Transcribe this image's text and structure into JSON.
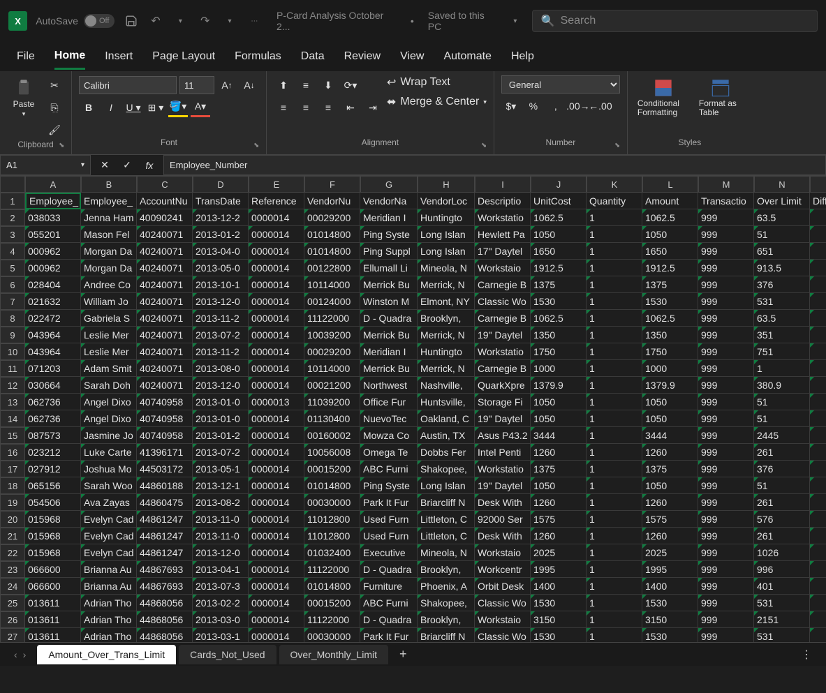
{
  "app": {
    "icon_letter": "X",
    "autosave_label": "AutoSave",
    "autosave_state": "Off",
    "filename": "P-Card Analysis October 2...",
    "save_status": "Saved to this PC",
    "search_placeholder": "Search"
  },
  "tabs": {
    "file": "File",
    "home": "Home",
    "insert": "Insert",
    "page_layout": "Page Layout",
    "formulas": "Formulas",
    "data": "Data",
    "review": "Review",
    "view": "View",
    "automate": "Automate",
    "help": "Help"
  },
  "ribbon": {
    "clipboard": {
      "paste": "Paste",
      "label": "Clipboard"
    },
    "font": {
      "name": "Calibri",
      "size": "11",
      "label": "Font"
    },
    "alignment": {
      "wrap": "Wrap Text",
      "merge": "Merge & Center",
      "label": "Alignment"
    },
    "number": {
      "format": "General",
      "label": "Number"
    },
    "styles": {
      "conditional": "Conditional Formatting",
      "format_table": "Format as Table",
      "label": "Styles"
    }
  },
  "name_box": "A1",
  "formula_bar": "Employee_Number",
  "columns": [
    "A",
    "B",
    "C",
    "D",
    "E",
    "F",
    "G",
    "H",
    "I",
    "J",
    "K",
    "L",
    "M",
    "N"
  ],
  "headers": [
    "Employee_",
    "Employee_",
    "AccountNu",
    "TransDate",
    "Reference",
    "VendorNu",
    "VendorNa",
    "VendorLoc",
    "Descriptio",
    "UnitCost",
    "Quantity",
    "Amount",
    "Transactio",
    "Over Limit",
    "Diff"
  ],
  "rows": [
    [
      "038033",
      "Jenna Ham",
      "40090241",
      "2013-12-2",
      "0000014",
      "00029200",
      "Meridian I",
      "Huntingto",
      "Workstatio",
      "1062.5",
      "1",
      "1062.5",
      "999",
      "63.5"
    ],
    [
      "055201",
      "Mason Fel",
      "40240071",
      "2013-01-2",
      "0000014",
      "01014800",
      "Ping Syste",
      "Long Islan",
      "Hewlett Pa",
      "1050",
      "1",
      "1050",
      "999",
      "51"
    ],
    [
      "000962",
      "Morgan Da",
      "40240071",
      "2013-04-0",
      "0000014",
      "01014800",
      "Ping Suppl",
      "Long Islan",
      "17\" Daytel",
      "1650",
      "1",
      "1650",
      "999",
      "651"
    ],
    [
      "000962",
      "Morgan Da",
      "40240071",
      "2013-05-0",
      "0000014",
      "00122800",
      "Ellumall Li",
      "Mineola, N",
      "Workstaio",
      "1912.5",
      "1",
      "1912.5",
      "999",
      "913.5"
    ],
    [
      "028404",
      "Andree Co",
      "40240071",
      "2013-10-1",
      "0000014",
      "10114000",
      "Merrick Bu",
      "Merrick, N",
      "Carnegie B",
      "1375",
      "1",
      "1375",
      "999",
      "376"
    ],
    [
      "021632",
      "William Jo",
      "40240071",
      "2013-12-0",
      "0000014",
      "00124000",
      "Winston M",
      "Elmont, NY",
      "Classic Wo",
      "1530",
      "1",
      "1530",
      "999",
      "531"
    ],
    [
      "022472",
      "Gabriela S",
      "40240071",
      "2013-11-2",
      "0000014",
      "11122000",
      "D - Quadra",
      "Brooklyn, ",
      "Carnegie B",
      "1062.5",
      "1",
      "1062.5",
      "999",
      "63.5"
    ],
    [
      "043964",
      "Leslie Mer",
      "40240071",
      "2013-07-2",
      "0000014",
      "10039200",
      "Merrick Bu",
      "Merrick, N",
      "19\" Daytel",
      "1350",
      "1",
      "1350",
      "999",
      "351"
    ],
    [
      "043964",
      "Leslie Mer",
      "40240071",
      "2013-11-2",
      "0000014",
      "00029200",
      "Meridian I",
      "Huntingto",
      "Workstatio",
      "1750",
      "1",
      "1750",
      "999",
      "751"
    ],
    [
      "071203",
      "Adam Smit",
      "40240071",
      "2013-08-0",
      "0000014",
      "10114000",
      "Merrick Bu",
      "Merrick, N",
      "Carnegie B",
      "1000",
      "1",
      "1000",
      "999",
      "1"
    ],
    [
      "030664",
      "Sarah Doh",
      "40240071",
      "2013-12-0",
      "0000014",
      "00021200",
      "Northwest",
      "Nashville, ",
      "QuarkXpre",
      "1379.9",
      "1",
      "1379.9",
      "999",
      "380.9"
    ],
    [
      "062736",
      "Angel Dixo",
      "40740958",
      "2013-01-0",
      "0000013",
      "11039200",
      "Office Fur",
      "Huntsville,",
      "Storage Fi",
      "1050",
      "1",
      "1050",
      "999",
      "51"
    ],
    [
      "062736",
      "Angel Dixo",
      "40740958",
      "2013-01-0",
      "0000014",
      "01130400",
      "NuevoTec",
      "Oakland, C",
      "19\" Daytel",
      "1050",
      "1",
      "1050",
      "999",
      "51"
    ],
    [
      "087573",
      "Jasmine Jo",
      "40740958",
      "2013-01-2",
      "0000014",
      "00160002",
      "Mowza Co",
      "Austin, TX",
      "Asus P43.2",
      "3444",
      "1",
      "3444",
      "999",
      "2445"
    ],
    [
      "023212",
      "Luke Carte",
      "41396171",
      "2013-07-2",
      "0000014",
      "10056008",
      "Omega Te",
      "Dobbs Fer",
      "Intel Penti",
      "1260",
      "1",
      "1260",
      "999",
      "261"
    ],
    [
      "027912",
      "Joshua Mo",
      "44503172",
      "2013-05-1",
      "0000014",
      "00015200",
      "ABC Furni",
      "Shakopee,",
      "Workstatio",
      "1375",
      "1",
      "1375",
      "999",
      "376"
    ],
    [
      "065156",
      "Sarah Woo",
      "44860188",
      "2013-12-1",
      "0000014",
      "01014800",
      "Ping Syste",
      "Long Islan",
      "19\" Daytel",
      "1050",
      "1",
      "1050",
      "999",
      "51"
    ],
    [
      "054506",
      "Ava Zayas",
      "44860475",
      "2013-08-2",
      "0000014",
      "00030000",
      "Park It Fur",
      "Briarcliff N",
      "Desk With",
      "1260",
      "1",
      "1260",
      "999",
      "261"
    ],
    [
      "015968",
      "Evelyn Cad",
      "44861247",
      "2013-11-0",
      "0000014",
      "11012800",
      "Used Furn",
      "Littleton, C",
      "92000 Ser",
      "1575",
      "1",
      "1575",
      "999",
      "576"
    ],
    [
      "015968",
      "Evelyn Cad",
      "44861247",
      "2013-11-0",
      "0000014",
      "11012800",
      "Used Furn",
      "Littleton, C",
      "Desk With",
      "1260",
      "1",
      "1260",
      "999",
      "261"
    ],
    [
      "015968",
      "Evelyn Cad",
      "44861247",
      "2013-12-0",
      "0000014",
      "01032400",
      "Executive ",
      "Mineola, N",
      "Workstaio",
      "2025",
      "1",
      "2025",
      "999",
      "1026"
    ],
    [
      "066600",
      "Brianna Au",
      "44867693",
      "2013-04-1",
      "0000014",
      "11122000",
      "D - Quadra",
      "Brooklyn, ",
      "Workcentr",
      "1995",
      "1",
      "1995",
      "999",
      "996"
    ],
    [
      "066600",
      "Brianna Au",
      "44867693",
      "2013-07-3",
      "0000014",
      "01014800",
      "Furniture ",
      "Phoenix, A",
      "Orbit Desk",
      "1400",
      "1",
      "1400",
      "999",
      "401"
    ],
    [
      "013611",
      "Adrian Tho",
      "44868056",
      "2013-02-2",
      "0000014",
      "00015200",
      "ABC Furni",
      "Shakopee,",
      "Classic Wo",
      "1530",
      "1",
      "1530",
      "999",
      "531"
    ],
    [
      "013611",
      "Adrian Tho",
      "44868056",
      "2013-03-0",
      "0000014",
      "11122000",
      "D - Quadra",
      "Brooklyn, ",
      "Workstaio",
      "3150",
      "1",
      "3150",
      "999",
      "2151"
    ],
    [
      "013611",
      "Adrian Tho",
      "44868056",
      "2013-03-1",
      "0000014",
      "00030000",
      "Park It Fur",
      "Briarcliff N",
      "Classic Wo",
      "1530",
      "1",
      "1530",
      "999",
      "531"
    ]
  ],
  "sheets": {
    "active": "Amount_Over_Trans_Limit",
    "t1": "Amount_Over_Trans_Limit",
    "t2": "Cards_Not_Used",
    "t3": "Over_Monthly_Limit"
  }
}
